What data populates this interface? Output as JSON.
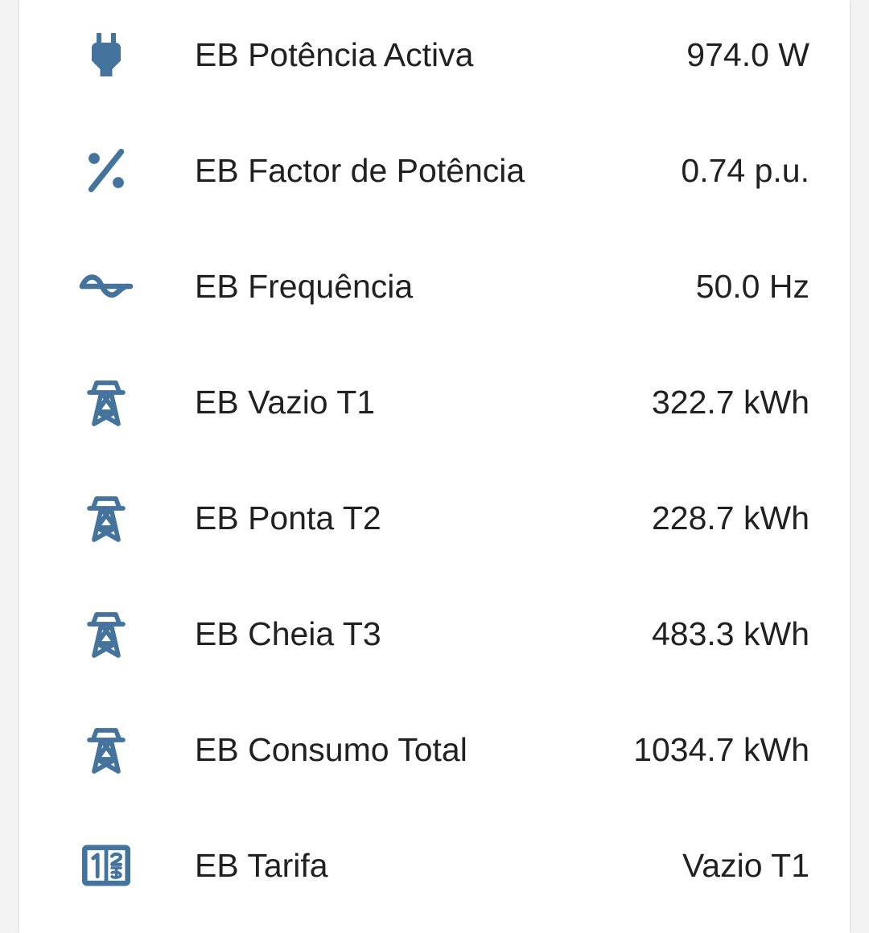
{
  "theme": {
    "icon_color": "#44739e",
    "text_color": "#212121"
  },
  "entities": [
    {
      "icon": "power-plug-icon",
      "name": "EB Potência Activa",
      "value": "974.0 W"
    },
    {
      "icon": "percent-icon",
      "name": "EB Factor de Potência",
      "value": "0.74 p.u."
    },
    {
      "icon": "sine-wave-icon",
      "name": "EB Frequência",
      "value": "50.0 Hz"
    },
    {
      "icon": "transmission-tower-icon",
      "name": "EB Vazio T1",
      "value": "322.7 kWh"
    },
    {
      "icon": "transmission-tower-icon",
      "name": "EB Ponta T2",
      "value": "228.7 kWh"
    },
    {
      "icon": "transmission-tower-icon",
      "name": "EB Cheia T3",
      "value": "483.3 kWh"
    },
    {
      "icon": "transmission-tower-icon",
      "name": "EB Consumo Total",
      "value": "1034.7 kWh"
    },
    {
      "icon": "numeric-box-icon",
      "name": "EB Tarifa",
      "value": "Vazio T1"
    }
  ]
}
